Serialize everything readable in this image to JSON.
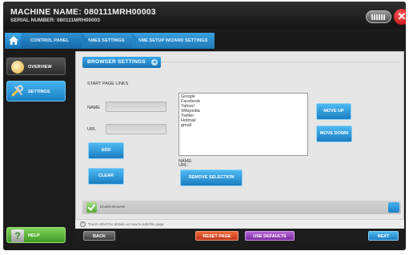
{
  "titlebar": {
    "machine_name": "MACHINE NAME: 080111MRH00003",
    "serial_number": "SERIAL NUMBER: 080111MRH00003",
    "keyboard_icon": "keyboard-icon",
    "close_label": "✕"
  },
  "breadcrumb": {
    "home_icon": "home-icon",
    "items": [
      "CONTROL PANEL",
      "GAMES SETTINGS",
      "GAME SETUP WIZARD SETTINGS"
    ]
  },
  "sidebar": {
    "items": [
      {
        "label": "OVERVIEW",
        "icon": "overview-icon"
      },
      {
        "label": "SETTINGS",
        "icon": "tools-icon"
      }
    ],
    "help_label": "HELP",
    "help_glyph": "?"
  },
  "main": {
    "section_title": "BROWSER SETTINGS",
    "section_arrow": "◂",
    "start_page_links_label": "START PAGE LINKS",
    "name_label": "NAME",
    "url_label": "URL",
    "name_value": "",
    "url_value": "",
    "add_label": "ADD",
    "clear_label": "CLEAR",
    "links": [
      "Google",
      "Facebook",
      "Yahoo!",
      "Wikipedia",
      "Twitter",
      "Hotmail",
      "gmail"
    ],
    "selected_name_label": "NAME:",
    "selected_url_label": "URL:",
    "remove_label": "REMOVE SELECTION",
    "move_up_label": "MOVE UP",
    "move_down_label": "MOVE DOWN",
    "enable_browser_label": "Enable Browser",
    "enable_browser_checked": true
  },
  "hint": {
    "icon": "info-icon",
    "text": "Touch HELP for details on how to edit this page"
  },
  "footer": {
    "back_label": "BACK",
    "reset_label": "RESET PAGE",
    "defaults_label": "USE DEFAULTS",
    "next_label": "NEXT"
  },
  "colors": {
    "accent_blue": "#1a7dc2",
    "help_green": "#3f9b27",
    "reset_orange": "#c0361a",
    "defaults_purple": "#7a2aa0",
    "close_red": "#b30000"
  }
}
